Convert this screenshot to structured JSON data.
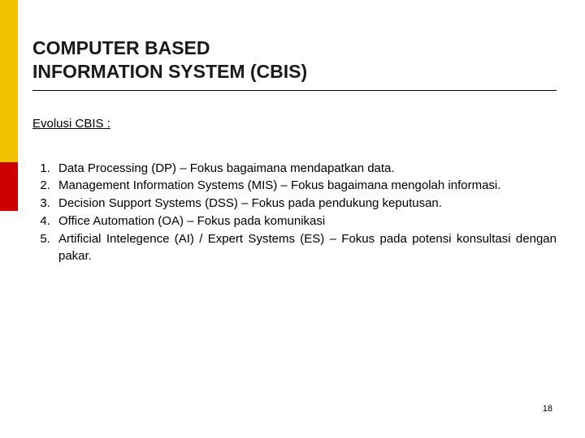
{
  "title_line1": "COMPUTER BASED",
  "title_line2": "INFORMATION SYSTEM (CBIS)",
  "subheading": "Evolusi CBIS :",
  "items": [
    "Data Processing (DP) – Fokus bagaimana mendapatkan data.",
    "Management Information Systems (MIS) – Fokus bagaimana mengolah informasi.",
    "Decision Support Systems (DSS) – Fokus pada pendukung keputusan.",
    "Office Automation (OA) – Fokus pada komunikasi",
    "Artificial Intelegence (AI) / Expert Systems (ES) – Fokus pada potensi konsultasi dengan pakar."
  ],
  "page_number": "18"
}
